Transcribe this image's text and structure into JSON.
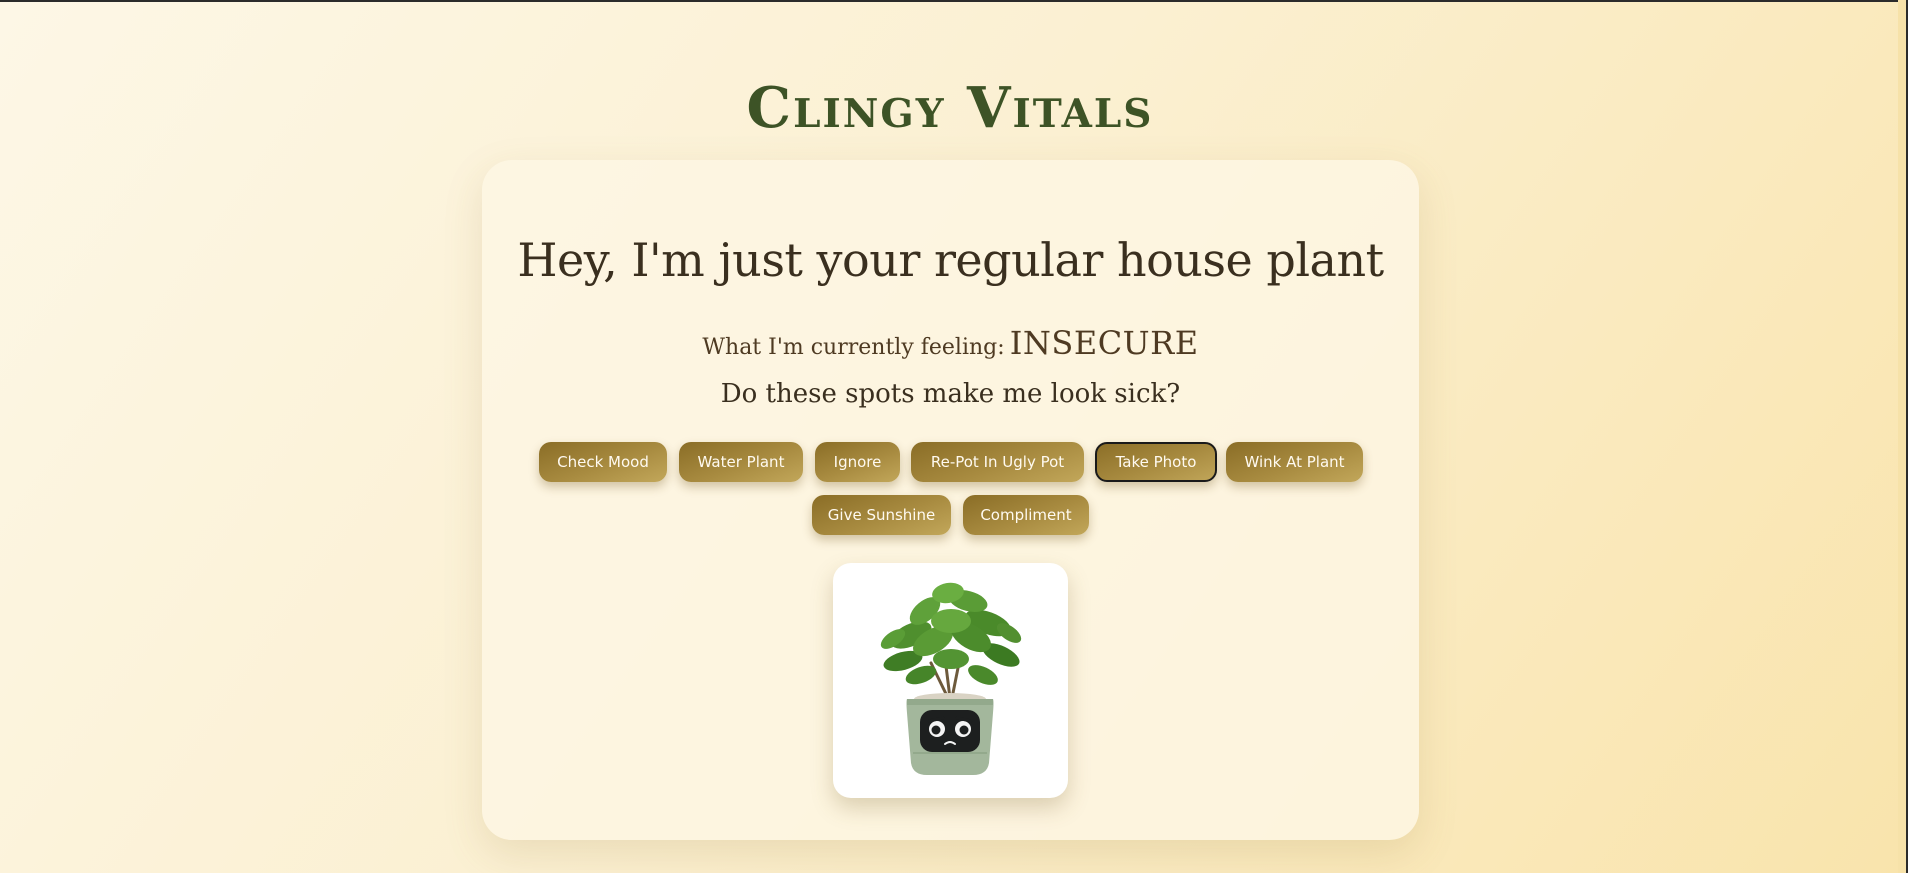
{
  "app": {
    "title": "Clingy Vitals"
  },
  "card": {
    "headline": "Hey, I'm just your regular house plant",
    "feeling_label": "What I'm currently feeling:",
    "feeling_value": "INSECURE",
    "message": "Do these spots make me look sick?"
  },
  "actions": [
    {
      "label": "Check Mood"
    },
    {
      "label": "Water Plant"
    },
    {
      "label": "Ignore"
    },
    {
      "label": "Re-Pot In Ugly Pot"
    },
    {
      "label": "Take Photo",
      "focused": true
    },
    {
      "label": "Wink At Plant"
    },
    {
      "label": "Give Sunshine"
    },
    {
      "label": "Compliment"
    }
  ],
  "plant_image": {
    "icon": "potted-plant-with-sad-face",
    "mood": "sad"
  },
  "colors": {
    "title_green": "#3d5326",
    "button_gold": "#a88b40",
    "background": "#fbf0d2",
    "pot_sage": "#a3b79c",
    "leaf_green": "#4f8f2e"
  }
}
